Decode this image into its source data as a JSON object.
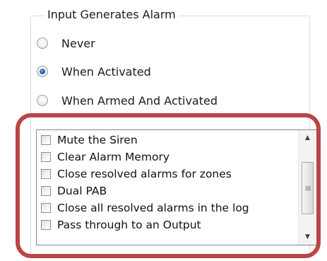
{
  "group": {
    "title": "Input Generates Alarm",
    "options": [
      {
        "label": "Never",
        "checked": false
      },
      {
        "label": "When Activated",
        "checked": true
      },
      {
        "label": "When Armed And Activated",
        "checked": false
      }
    ]
  },
  "list": {
    "items": [
      {
        "label": "Mute the Siren",
        "checked": false
      },
      {
        "label": "Clear Alarm Memory",
        "checked": false
      },
      {
        "label": "Close resolved alarms for zones",
        "checked": false
      },
      {
        "label": "Dual PAB",
        "checked": false
      },
      {
        "label": "Close all resolved alarms in the log",
        "checked": false
      },
      {
        "label": "Pass through to an Output",
        "checked": false
      }
    ],
    "scroll": {
      "up_icon": "scroll-up-arrow",
      "down_icon": "scroll-down-arrow",
      "grip_icon": "scroll-grip"
    }
  },
  "colors": {
    "highlight_border": "#b94646",
    "radio_selected": "#2b5fa8",
    "groupbox_border": "#d5dfe5"
  }
}
